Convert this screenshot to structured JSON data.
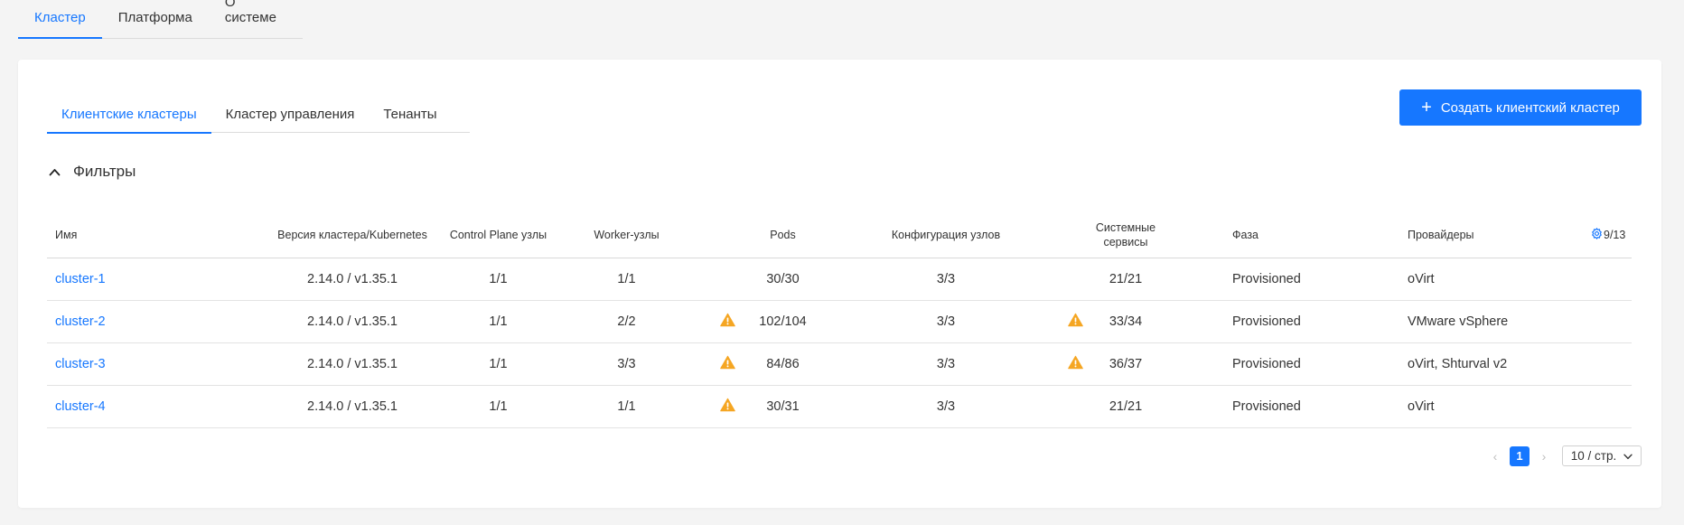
{
  "top_tabs": [
    {
      "label": "Кластер",
      "active": true
    },
    {
      "label": "Платформа",
      "active": false
    },
    {
      "label": "О системе",
      "active": false
    }
  ],
  "sub_tabs": [
    {
      "label": "Клиентские кластеры",
      "active": true
    },
    {
      "label": "Кластер управления",
      "active": false
    },
    {
      "label": "Тенанты",
      "active": false
    }
  ],
  "create_button": {
    "label": "Создать клиентский кластер",
    "icon": "plus-icon"
  },
  "filters": {
    "label": "Фильтры",
    "icon": "chevron-up-icon"
  },
  "table": {
    "headers": {
      "name": "Имя",
      "version": "Версия кластера/Kubernetes",
      "control_plane": "Control Plane узлы",
      "workers": "Worker-узлы",
      "pods": "Pods",
      "node_config": "Конфигурация узлов",
      "system_services_line1": "Системные",
      "system_services_line2": "сервисы",
      "phase": "Фаза",
      "providers": "Провайдеры",
      "columns_count": "9/13"
    },
    "rows": [
      {
        "name": "cluster-1",
        "version": "2.14.0 / v1.35.1",
        "control_plane": "1/1",
        "workers": "1/1",
        "pods": "30/30",
        "pods_warning": false,
        "node_config": "3/3",
        "system_services": "21/21",
        "services_warning": false,
        "phase": "Provisioned",
        "providers": "oVirt"
      },
      {
        "name": "cluster-2",
        "version": "2.14.0 / v1.35.1",
        "control_plane": "1/1",
        "workers": "2/2",
        "pods": "102/104",
        "pods_warning": true,
        "node_config": "3/3",
        "system_services": "33/34",
        "services_warning": true,
        "phase": "Provisioned",
        "providers": "VMware vSphere"
      },
      {
        "name": "cluster-3",
        "version": "2.14.0 / v1.35.1",
        "control_plane": "1/1",
        "workers": "3/3",
        "pods": "84/86",
        "pods_warning": true,
        "node_config": "3/3",
        "system_services": "36/37",
        "services_warning": true,
        "phase": "Provisioned",
        "providers": "oVirt, Shturval v2"
      },
      {
        "name": "cluster-4",
        "version": "2.14.0 / v1.35.1",
        "control_plane": "1/1",
        "workers": "1/1",
        "pods": "30/31",
        "pods_warning": true,
        "node_config": "3/3",
        "system_services": "21/21",
        "services_warning": false,
        "phase": "Provisioned",
        "providers": "oVirt"
      }
    ]
  },
  "pagination": {
    "current_page": "1",
    "page_size": "10 / стр."
  },
  "colors": {
    "accent": "#1677ff",
    "warning": "#f5a623"
  }
}
